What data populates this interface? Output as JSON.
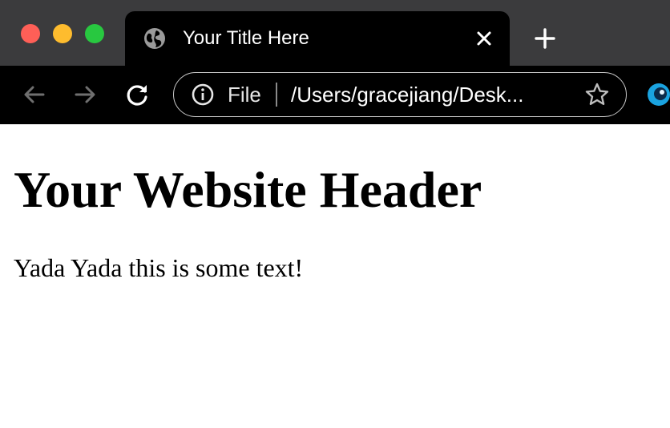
{
  "browser": {
    "tab": {
      "title": "Your Title Here",
      "icon": "globe-icon",
      "close_icon": "close-icon"
    },
    "new_tab_icon": "plus-icon",
    "toolbar": {
      "back_icon": "arrow-left-icon",
      "forward_icon": "arrow-right-icon",
      "reload_icon": "reload-icon"
    },
    "omnibox": {
      "info_icon": "info-icon",
      "scheme_label": "File",
      "url": "/Users/gracejiang/Desk...",
      "bookmark_icon": "star-icon"
    },
    "extension_icon": "extension-icon"
  },
  "page": {
    "header": "Your Website Header",
    "paragraph": "Yada Yada this is some text!"
  },
  "colors": {
    "tabstrip_bg": "#3b3b3d",
    "toolbar_bg": "#000000",
    "traffic_close": "#fe5f57",
    "traffic_minimize": "#febc2e",
    "traffic_maximize": "#28c840",
    "extension_accent": "#1aa3e0"
  }
}
